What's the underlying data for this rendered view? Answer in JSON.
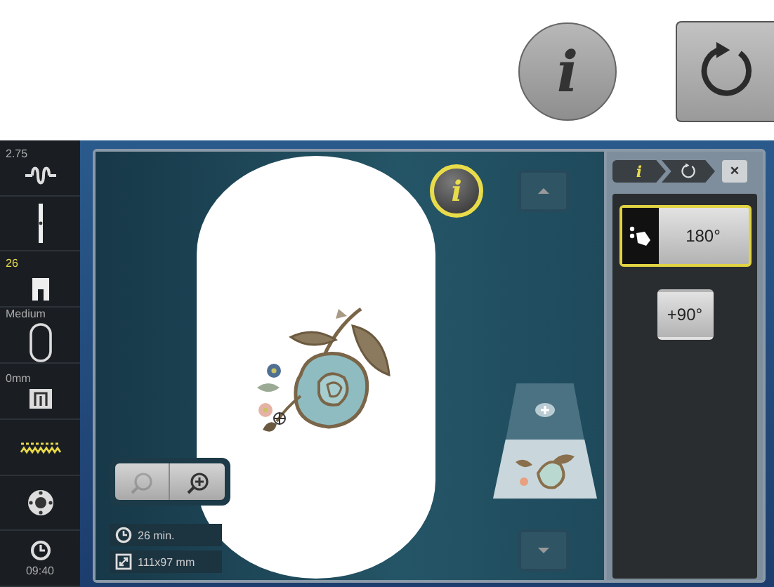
{
  "header_buttons": [
    {
      "kind": "info",
      "label": "i"
    },
    {
      "kind": "rotate"
    }
  ],
  "status_bar": {
    "items": [
      {
        "kind": "stitch-width",
        "value": "2.75",
        "active": false
      },
      {
        "kind": "needle"
      },
      {
        "kind": "foot",
        "value": "26",
        "active": true
      },
      {
        "kind": "hoop",
        "value": "Medium",
        "active": false
      },
      {
        "kind": "stitch-plate",
        "value": "0mm",
        "active": false
      },
      {
        "kind": "feed-dog"
      },
      {
        "kind": "bobbin"
      },
      {
        "kind": "clock",
        "value": "09:40",
        "active": false
      }
    ]
  },
  "canvas": {
    "info_button": {
      "label": "i",
      "selected": true
    },
    "zoom_buttons": [
      {
        "kind": "zoom-out",
        "disabled": true
      },
      {
        "kind": "zoom-in",
        "disabled": false
      }
    ],
    "stitch_time": "26 min.",
    "design_size": "111x97 mm"
  },
  "panel": {
    "breadcrumb": [
      {
        "kind": "info",
        "label": "i"
      },
      {
        "kind": "rotate"
      }
    ],
    "close": "×",
    "rotate_buttons": [
      {
        "kind": "touch",
        "label": "180°",
        "selected": true
      },
      {
        "kind": "plain",
        "label": "+90°",
        "selected": false
      }
    ]
  }
}
